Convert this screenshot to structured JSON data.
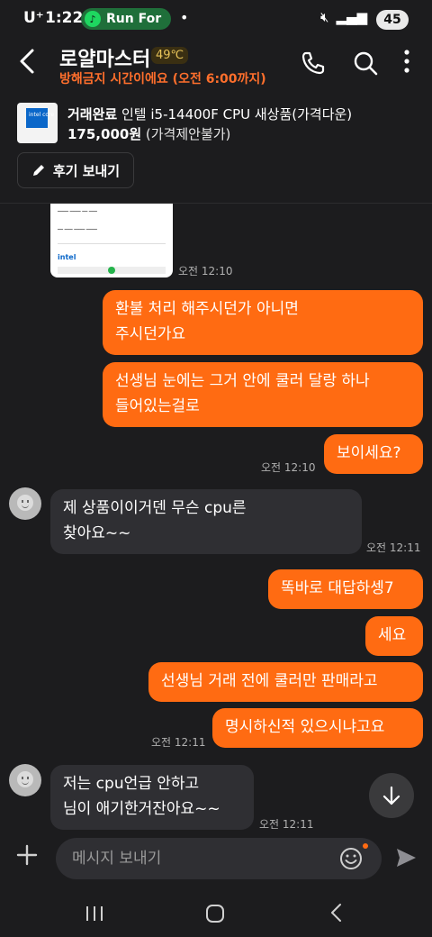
{
  "status_bar": {
    "carrier": "U⁺",
    "time": "1:22",
    "music_app": "Run For",
    "battery": "45"
  },
  "header": {
    "title": "로얄마스터",
    "temperature": "49℃",
    "subtitle": "방해금지 시간이에요 (오전 6:00까지)"
  },
  "product": {
    "status": "거래완료",
    "name": "인텔 i5-14400F CPU 새상품(가격다운)",
    "price": "175,000원",
    "price_note": "(가격제안불가)",
    "thumb_text": "intel core"
  },
  "review_button": {
    "label": "후기 보내기"
  },
  "image_message": {
    "brand": "intel",
    "time": "오전 12:10"
  },
  "messages": [
    {
      "from": "me",
      "lines": [
        "환불 처리 해주시던가 아니면",
        "주시던가요"
      ]
    },
    {
      "from": "me",
      "lines": [
        "선생님 눈에는 그거 안에 쿨러 달랑 하나",
        "들어있는걸로"
      ]
    },
    {
      "from": "me",
      "lines": [
        "보이세요?"
      ],
      "time": "오전 12:10"
    },
    {
      "from": "them",
      "lines": [
        "제 상품이이거덴 무슨 cpu른",
        "찾아요~~"
      ],
      "time": "오전 12:11"
    },
    {
      "from": "me",
      "lines": [
        "똑바로 대답하셍7"
      ]
    },
    {
      "from": "me",
      "lines": [
        "세요"
      ]
    },
    {
      "from": "me",
      "lines": [
        "선생님 거래 전에 쿨러만 판매라고"
      ]
    },
    {
      "from": "me",
      "lines": [
        "명시하신적 있으시냐고요"
      ],
      "time": "오전 12:11"
    },
    {
      "from": "them",
      "lines": [
        "저는 cpu언급 안하고",
        "님이 애기한거잔아요~~"
      ],
      "time": "오전 12:11"
    }
  ],
  "input": {
    "placeholder": "메시지 보내기"
  },
  "colors": {
    "accent": "#ff6b12",
    "background": "#1c1c1e",
    "other_bubble": "#2f2f33",
    "badge_text": "#e8c45a"
  }
}
